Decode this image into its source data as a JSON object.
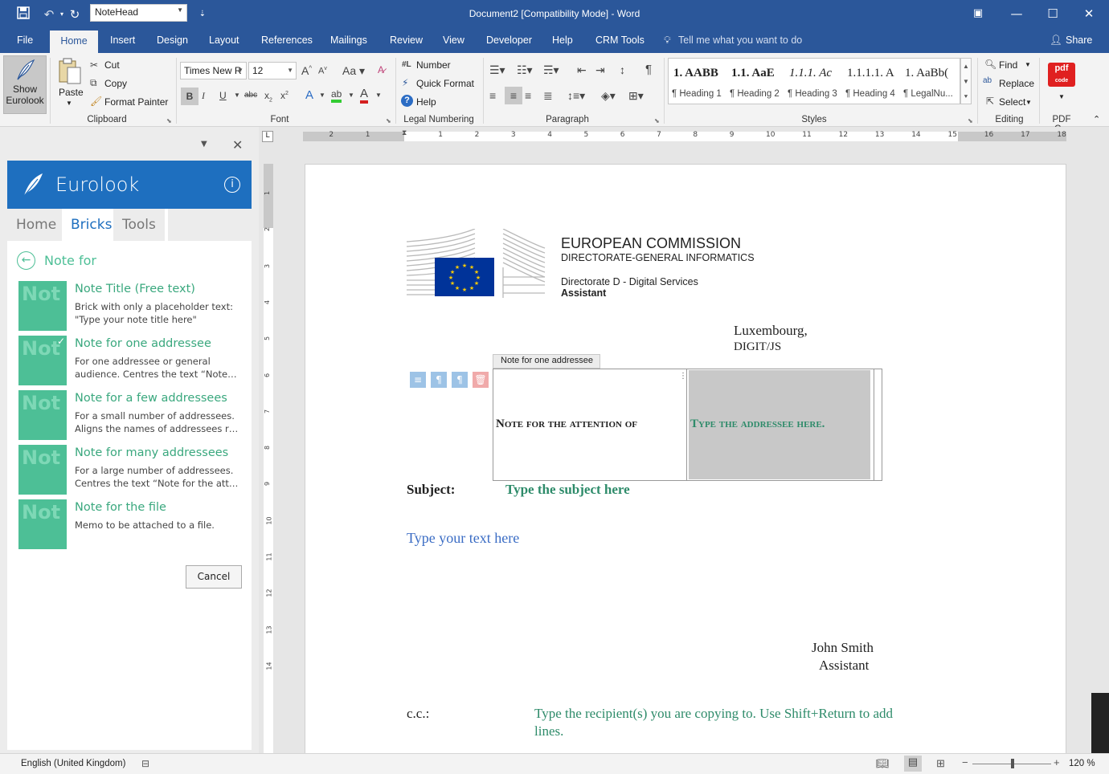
{
  "titlebar": {
    "style_box": "NoteHead",
    "document_title": "Document2 [Compatibility Mode]  -  Word"
  },
  "menu": {
    "tabs": [
      "File",
      "Home",
      "Insert",
      "Design",
      "Layout",
      "References",
      "Mailings",
      "Review",
      "View",
      "Developer",
      "Help",
      "CRM Tools"
    ],
    "tell_me": "Tell me what you want to do",
    "share": "Share"
  },
  "ribbon": {
    "show_eurolook": [
      "Show",
      "Eurolook"
    ],
    "paste": "Paste",
    "cut": "Cut",
    "copy": "Copy",
    "format_painter": "Format Painter",
    "group_clipboard": "Clipboard",
    "font_name": "Times New R",
    "font_size": "12",
    "group_font": "Font",
    "number": "Number",
    "quick_format": "Quick Format",
    "help": "Help",
    "group_legal": "Legal Numbering",
    "group_paragraph": "Paragraph",
    "styles": [
      {
        "sample": "1.  AABB",
        "name": "¶ Heading 1"
      },
      {
        "sample": "1.1.  AaE",
        "name": "¶ Heading 2"
      },
      {
        "sample": "1.1.1.  Ac",
        "name": "¶ Heading 3"
      },
      {
        "sample": "1.1.1.1.  A",
        "name": "¶ Heading 4"
      },
      {
        "sample": "1.  AaBb(",
        "name": "¶ LegalNu..."
      }
    ],
    "group_styles": "Styles",
    "find": "Find",
    "replace": "Replace",
    "select": "Select",
    "group_editing": "Editing",
    "group_pdf": "PDF C..."
  },
  "panel": {
    "title": "Eurolook",
    "tabs": [
      "Home",
      "Bricks",
      "Tools"
    ],
    "back_label": "Note for",
    "thumb_text": "Not",
    "bricks": [
      {
        "title": "Note Title (Free text)",
        "desc1": "Brick with only a placeholder text:",
        "desc2": "\"Type your note title here\""
      },
      {
        "title": "Note for one addressee",
        "desc1": "For one addressee or general",
        "desc2": "audience. Centres the text “Note fo..."
      },
      {
        "title": "Note for a few addressees",
        "desc1": "For a small number of addressees.",
        "desc2": "Aligns the names of addressees rig..."
      },
      {
        "title": "Note for many addressees",
        "desc1": "For a large number of addressees.",
        "desc2": "Centres the text “Note for the atten..."
      },
      {
        "title": "Note for the file",
        "desc1": "Memo to be attached to a file.",
        "desc2": ""
      }
    ],
    "cancel": "Cancel"
  },
  "ruler": {
    "numbers": [
      "2",
      "1",
      "1",
      "2",
      "3",
      "4",
      "5",
      "6",
      "7",
      "8",
      "9",
      "10",
      "11",
      "12",
      "13",
      "14",
      "15",
      "16",
      "17",
      "18"
    ],
    "vnumbers": [
      "1",
      "2",
      "3",
      "4",
      "5",
      "6",
      "7",
      "8",
      "9",
      "10",
      "11",
      "12",
      "13",
      "14"
    ]
  },
  "document": {
    "org": "EUROPEAN COMMISSION",
    "dg": "DIRECTORATE-GENERAL INFORMATICS",
    "directorate": "Directorate D - Digital Services",
    "role": "Assistant",
    "place": "Luxembourg,",
    "ref": "DIGIT/JS",
    "cc_tag": "Note for one addressee",
    "attention": "Note for the attention of",
    "addressee": "Type the addressee here.",
    "subject_label": "Subject:",
    "subject": "Type the subject here",
    "body": "Type your text here",
    "sign_name": "John Smith",
    "sign_role": "Assistant",
    "cc_label": "c.c.:",
    "cc_text1": "Type the recipient(s) you are copying to. Use Shift+Return to add",
    "cc_text2": "lines."
  },
  "status": {
    "language": "English (United Kingdom)",
    "zoom": "120 %"
  },
  "colors": {
    "word_blue": "#2b579a",
    "eurolook_blue": "#1e6fbf",
    "brick_green": "#4dbf96",
    "placeholder_green": "#2e8b6a",
    "body_blue": "#3a6cc4"
  }
}
